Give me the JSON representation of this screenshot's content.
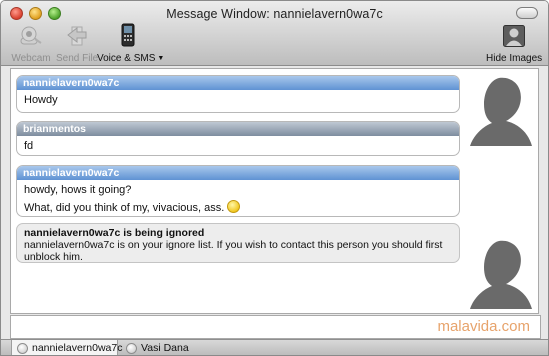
{
  "window": {
    "title": "Message Window: nannielavern0wa7c"
  },
  "toolbar": {
    "webcam_label": "Webcam",
    "send_file_label": "Send File",
    "voice_label": "Voice & SMS",
    "hide_images_label": "Hide Images"
  },
  "messages": [
    {
      "sender": "nannielavern0wa7c",
      "lines": [
        "Howdy"
      ]
    },
    {
      "sender": "brianmentos",
      "lines": [
        "fd"
      ]
    },
    {
      "sender": "nannielavern0wa7c",
      "lines": [
        "howdy, hows it going?",
        "What, did you think of my, vivacious, ass."
      ]
    }
  ],
  "notice": {
    "title": "nannielavern0wa7c is being ignored",
    "text": "nannielavern0wa7c is on your ignore list. If you wish to contact this person you should first unblock him."
  },
  "watermark": "malavida.com",
  "tabs": [
    {
      "label": "nannielavern0wa7c",
      "active": true
    },
    {
      "label": "Vasi Dana",
      "active": false
    }
  ],
  "colors": {
    "blue_header": "#5f92d3",
    "gray_header": "#7e8d9f",
    "watermark": "#e7a36b"
  },
  "icons": [
    "webcam-icon",
    "send-file-icon",
    "phone-icon",
    "hide-images-icon",
    "smiley-icon",
    "user-silhouette-icon"
  ]
}
